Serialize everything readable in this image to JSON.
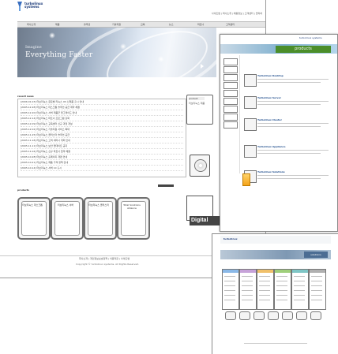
{
  "site": {
    "logo_text": "turbolinux systems",
    "top_links": "사이트맵 | 회사소개 | 채용정보 | 고객센터 | 연락처",
    "gnb": [
      "회사소개",
      "제품",
      "솔루션",
      "기술지원",
      "교육",
      "뉴스",
      "파트너",
      "고객센터"
    ],
    "hero": {
      "tagline_small": "Imagine",
      "tagline_main": "Everything Faster"
    },
    "news": {
      "title": "recent news",
      "rows": [
        "[2006.01.03] 터보리눅스 글로벌 리눅스 OS 신제품 출시 안내",
        "[2005.12.28] 터보리눅스 데스크톱 솔루션 공급 계약 체결",
        "[2005.12.20] 터보리눅스 서버 제품군 업그레이드 안내",
        "[2005.12.14] 터보리눅스 파트너 프로그램 강화",
        "[2005.12.09] 터보리눅스 교육센터 신규 과정 개설",
        "[2005.12.02] 터보리눅스 기술지원 서비스 확대",
        "[2005.11.25] 터보리눅스 클러스터 솔루션 공급",
        "[2005.11.18] 터보리눅스 고객 세미나 개최 안내",
        "[2005.11.11] 터보리눅스 보안 업데이트 공지",
        "[2005.11.04] 터보리눅스 신규 파트너 협약 체결",
        "[2005.10.28] 터보리눅스 홈페이지 개편 안내",
        "[2005.10.21] 터보리눅스 제품 가격 정책 안내",
        "[2005.10.14] 터보리눅스 서버 10 출시"
      ]
    },
    "side_panel": {
      "header": "product",
      "sub": "터보리눅스 제품"
    },
    "products_title": "products",
    "products": [
      {
        "label": "터보리눅스 데스크톱"
      },
      {
        "label": "터보리눅스 서버"
      },
      {
        "label": "터보리눅스 클러스터"
      },
      {
        "label": "Total Solutions Alliance"
      }
    ],
    "digital_label": "Digital",
    "footer": {
      "line1": "회사소개 | 개인정보보호정책 | 이용약관 | 사이트맵",
      "line2": "Copyright © turbolinux systems. All Rights Reserved."
    }
  },
  "panel_right": {
    "logo_text": "turbolinux systems",
    "banner": "products",
    "cards": [
      {
        "title": "Turbolinux Desktop"
      },
      {
        "title": "Turbolinux Server"
      },
      {
        "title": "Turbolinux Cluster"
      },
      {
        "title": "Turbolinux Appliance"
      },
      {
        "title": "Turbolinux Solutions"
      }
    ]
  },
  "panel_bottom": {
    "logo_text": "turbolinux",
    "band_pill": "solutions",
    "column_colors": [
      "#8bb9e8",
      "#c7a3d9",
      "#f0c06a",
      "#9fcf7b",
      "#7fc6c6",
      "#b0b0b0"
    ]
  },
  "colors": {
    "accent_green": "#4b8e2a",
    "brand_blue": "#1d3c7a"
  }
}
